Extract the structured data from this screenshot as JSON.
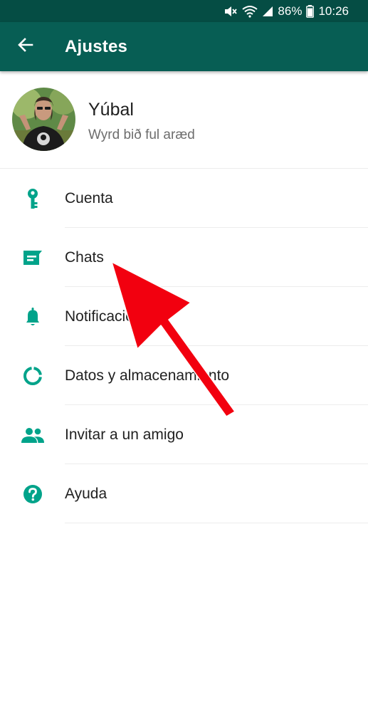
{
  "status_bar": {
    "battery": "86%",
    "time": "10:26"
  },
  "app_bar": {
    "title": "Ajustes",
    "back_icon": "arrow-left-icon"
  },
  "profile": {
    "name": "Yúbal",
    "status": "Wyrd bið ful aræd"
  },
  "menu": {
    "items": [
      {
        "label": "Cuenta",
        "icon": "key-icon"
      },
      {
        "label": "Chats",
        "icon": "chat-icon"
      },
      {
        "label": "Notificaciones",
        "icon": "bell-icon"
      },
      {
        "label": "Datos y almacenamiento",
        "icon": "data-usage-icon"
      },
      {
        "label": "Invitar a un amigo",
        "icon": "people-icon"
      },
      {
        "label": "Ayuda",
        "icon": "help-icon"
      }
    ]
  },
  "colors": {
    "status_bar": "#054d44",
    "app_bar": "#075e54",
    "icon_accent": "#00a38a",
    "annotation_arrow": "#f2000f"
  }
}
